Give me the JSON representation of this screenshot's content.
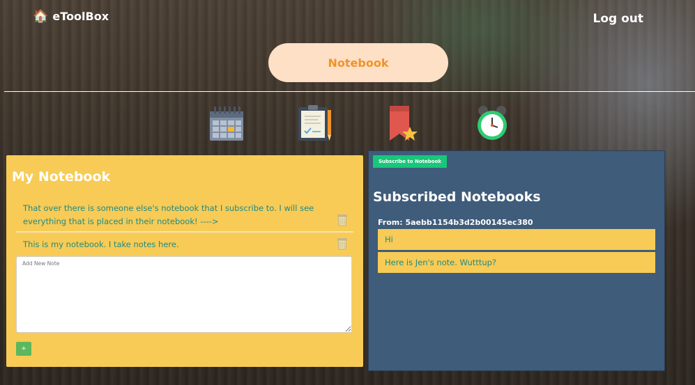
{
  "header": {
    "brand": "eToolBox",
    "logout": "Log out",
    "tab": "Notebook"
  },
  "icons": [
    "calendar-icon",
    "checklist-icon",
    "bookmark-icon",
    "alarm-clock-icon"
  ],
  "colors": {
    "my_notebook_bg": "#f7cb55",
    "subscribed_bg": "#3f5c7a",
    "note_text": "#1f8a86",
    "pill_bg": "#fde0c6",
    "pill_text": "#f0932b",
    "subscribe_button": "#18c77a",
    "add_button": "#5cb85c"
  },
  "my_notebook": {
    "title": "My Notebook",
    "notes": [
      {
        "text": "That over there is someone else's notebook that I subscribe to. I will see everything that is placed in their notebook! ---->"
      },
      {
        "text": "This is my notebook. I take notes here."
      }
    ],
    "new_note_placeholder": "Add New Note",
    "add_label": "+"
  },
  "subscribed": {
    "subscribe_button": "Subscribe to Notebook",
    "title": "Subscribed Notebooks",
    "from": "From: 5aebb1154b3d2b00145ec380",
    "notes": [
      {
        "text": "Hi"
      },
      {
        "text": "Here is Jen's note. Wutttup?"
      }
    ]
  }
}
